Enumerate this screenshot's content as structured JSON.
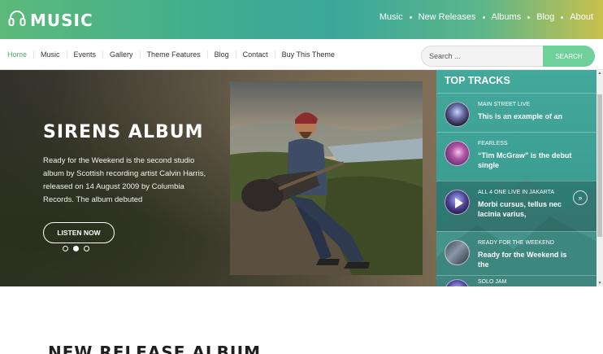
{
  "header": {
    "logo_text": "MUSIC",
    "logo_icon": "headphones-icon",
    "nav": [
      "Music",
      "New Releases",
      "Albums",
      "Blog",
      "About"
    ]
  },
  "subnav": {
    "items": [
      "Home",
      "Music",
      "Events",
      "Gallery",
      "Theme Features",
      "Blog",
      "Contact",
      "Buy This Theme"
    ],
    "search_placeholder": "Search ...",
    "search_button": "SEARCH"
  },
  "hero": {
    "title": "SIRENS ALBUM",
    "description": "Ready for the Weekend is the second studio album by Scottish recording artist Calvin Harris, released on 14 August 2009 by Columbia Records. The album debuted",
    "button": "LISTEN NOW",
    "slides": 3,
    "active_slide": 2
  },
  "top_tracks": {
    "title": "TOP TRACKS",
    "items": [
      {
        "artist": "MAIN STREET LIVE",
        "name": "This is an example of an"
      },
      {
        "artist": "FEARLESS",
        "name": "“Tim McGraw” is the debut single"
      },
      {
        "artist": "ALL 4 ONE LIVE IN JAKARTA",
        "name": "Morbi cursus, tellus nec lacinia varius,",
        "active": true
      },
      {
        "artist": "READY FOR THE WEEKEND",
        "name": "Ready for the Weekend is the"
      },
      {
        "artist": "SOLO JAM",
        "name": ""
      }
    ]
  },
  "section": {
    "title": "NEW RELEASE ALBUM"
  },
  "colors": {
    "accent": "#4caf73",
    "search_button": "#6fd09a",
    "tracks_bg": "#3c9e93"
  }
}
